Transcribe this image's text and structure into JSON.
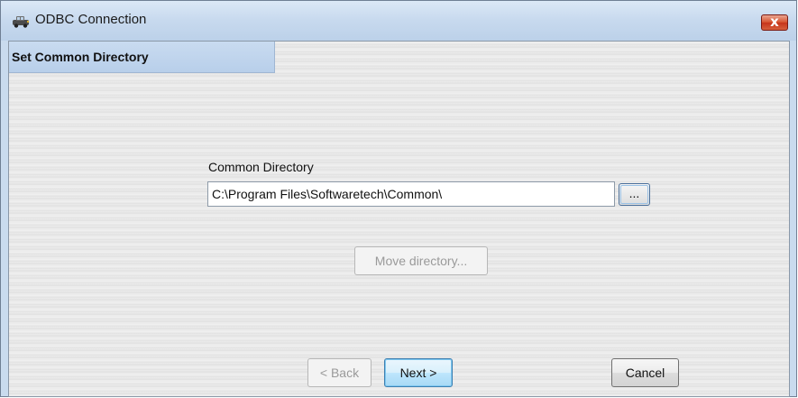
{
  "window": {
    "title": "ODBC Connection",
    "close_glyph": "x",
    "app_icon": "odbc-car-icon"
  },
  "header": {
    "label": "Set Common Directory"
  },
  "form": {
    "directory_label": "Common Directory",
    "directory_value": "C:\\Program Files\\Softwaretech\\Common\\",
    "browse_label": "..."
  },
  "buttons": {
    "move": "Move directory...",
    "back": "< Back",
    "next": "Next >",
    "cancel": "Cancel"
  }
}
